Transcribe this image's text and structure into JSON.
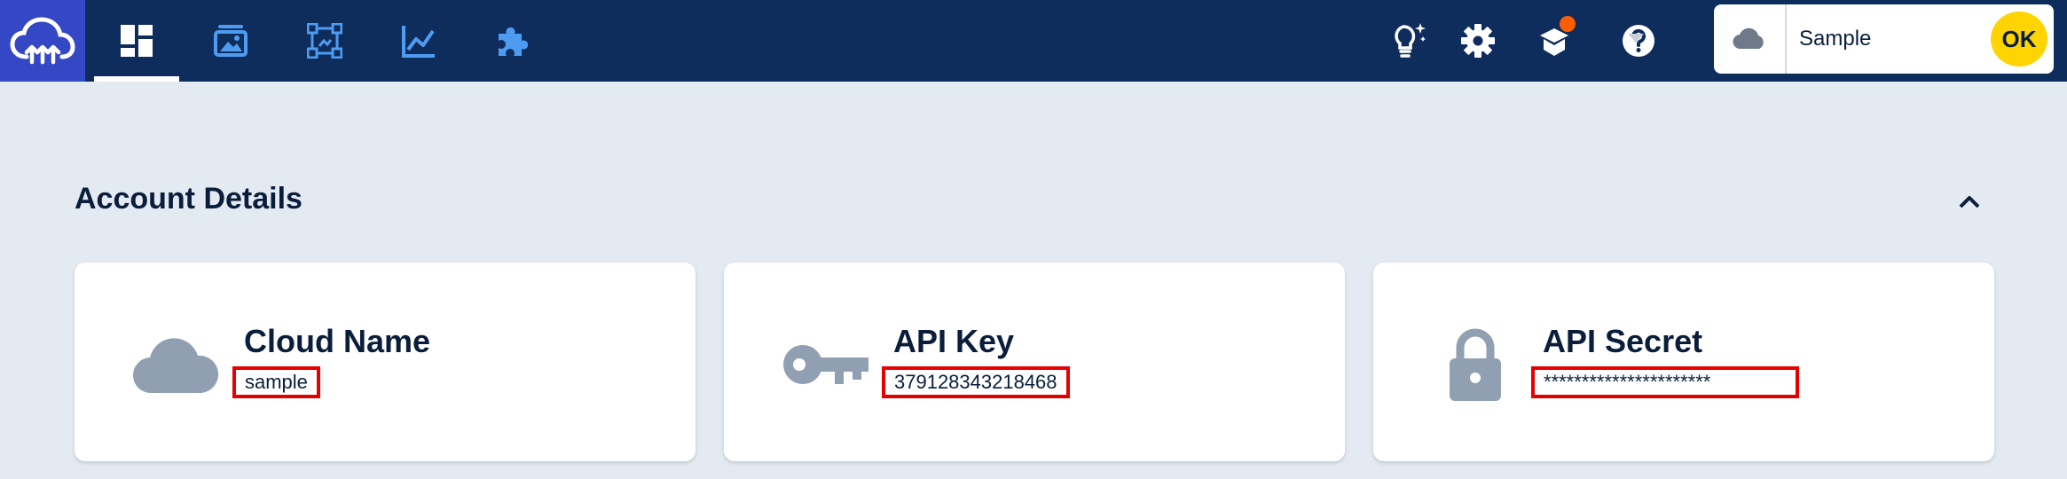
{
  "nav": {
    "logo_icon": "cloudinary-logo-icon",
    "items": [
      {
        "icon": "dashboard-icon",
        "active": true
      },
      {
        "icon": "media-library-icon",
        "active": false
      },
      {
        "icon": "transformations-icon",
        "active": false
      },
      {
        "icon": "reports-icon",
        "active": false
      },
      {
        "icon": "addons-icon",
        "active": false
      }
    ]
  },
  "header_icons": [
    "whats-new-icon",
    "settings-icon",
    "academy-icon",
    "help-icon"
  ],
  "account": {
    "cloud_name": "Sample",
    "avatar": "OK"
  },
  "section": {
    "title": "Account Details"
  },
  "cards": [
    {
      "icon": "cloud-icon",
      "title": "Cloud Name",
      "value": "sample"
    },
    {
      "icon": "key-icon",
      "title": "API Key",
      "value": "379128343218468"
    },
    {
      "icon": "lock-icon",
      "title": "API Secret",
      "value": "**********************"
    }
  ],
  "colors": {
    "topbar": "#0f2d5c",
    "logo_bg": "#3448c5",
    "nav_icon": "#4e9cf2",
    "badge": "#ff5d00",
    "avatar": "#ffd400",
    "highlight_border": "#e60000",
    "page_bg": "#e3eaf2",
    "card_icon": "#909fb2"
  }
}
